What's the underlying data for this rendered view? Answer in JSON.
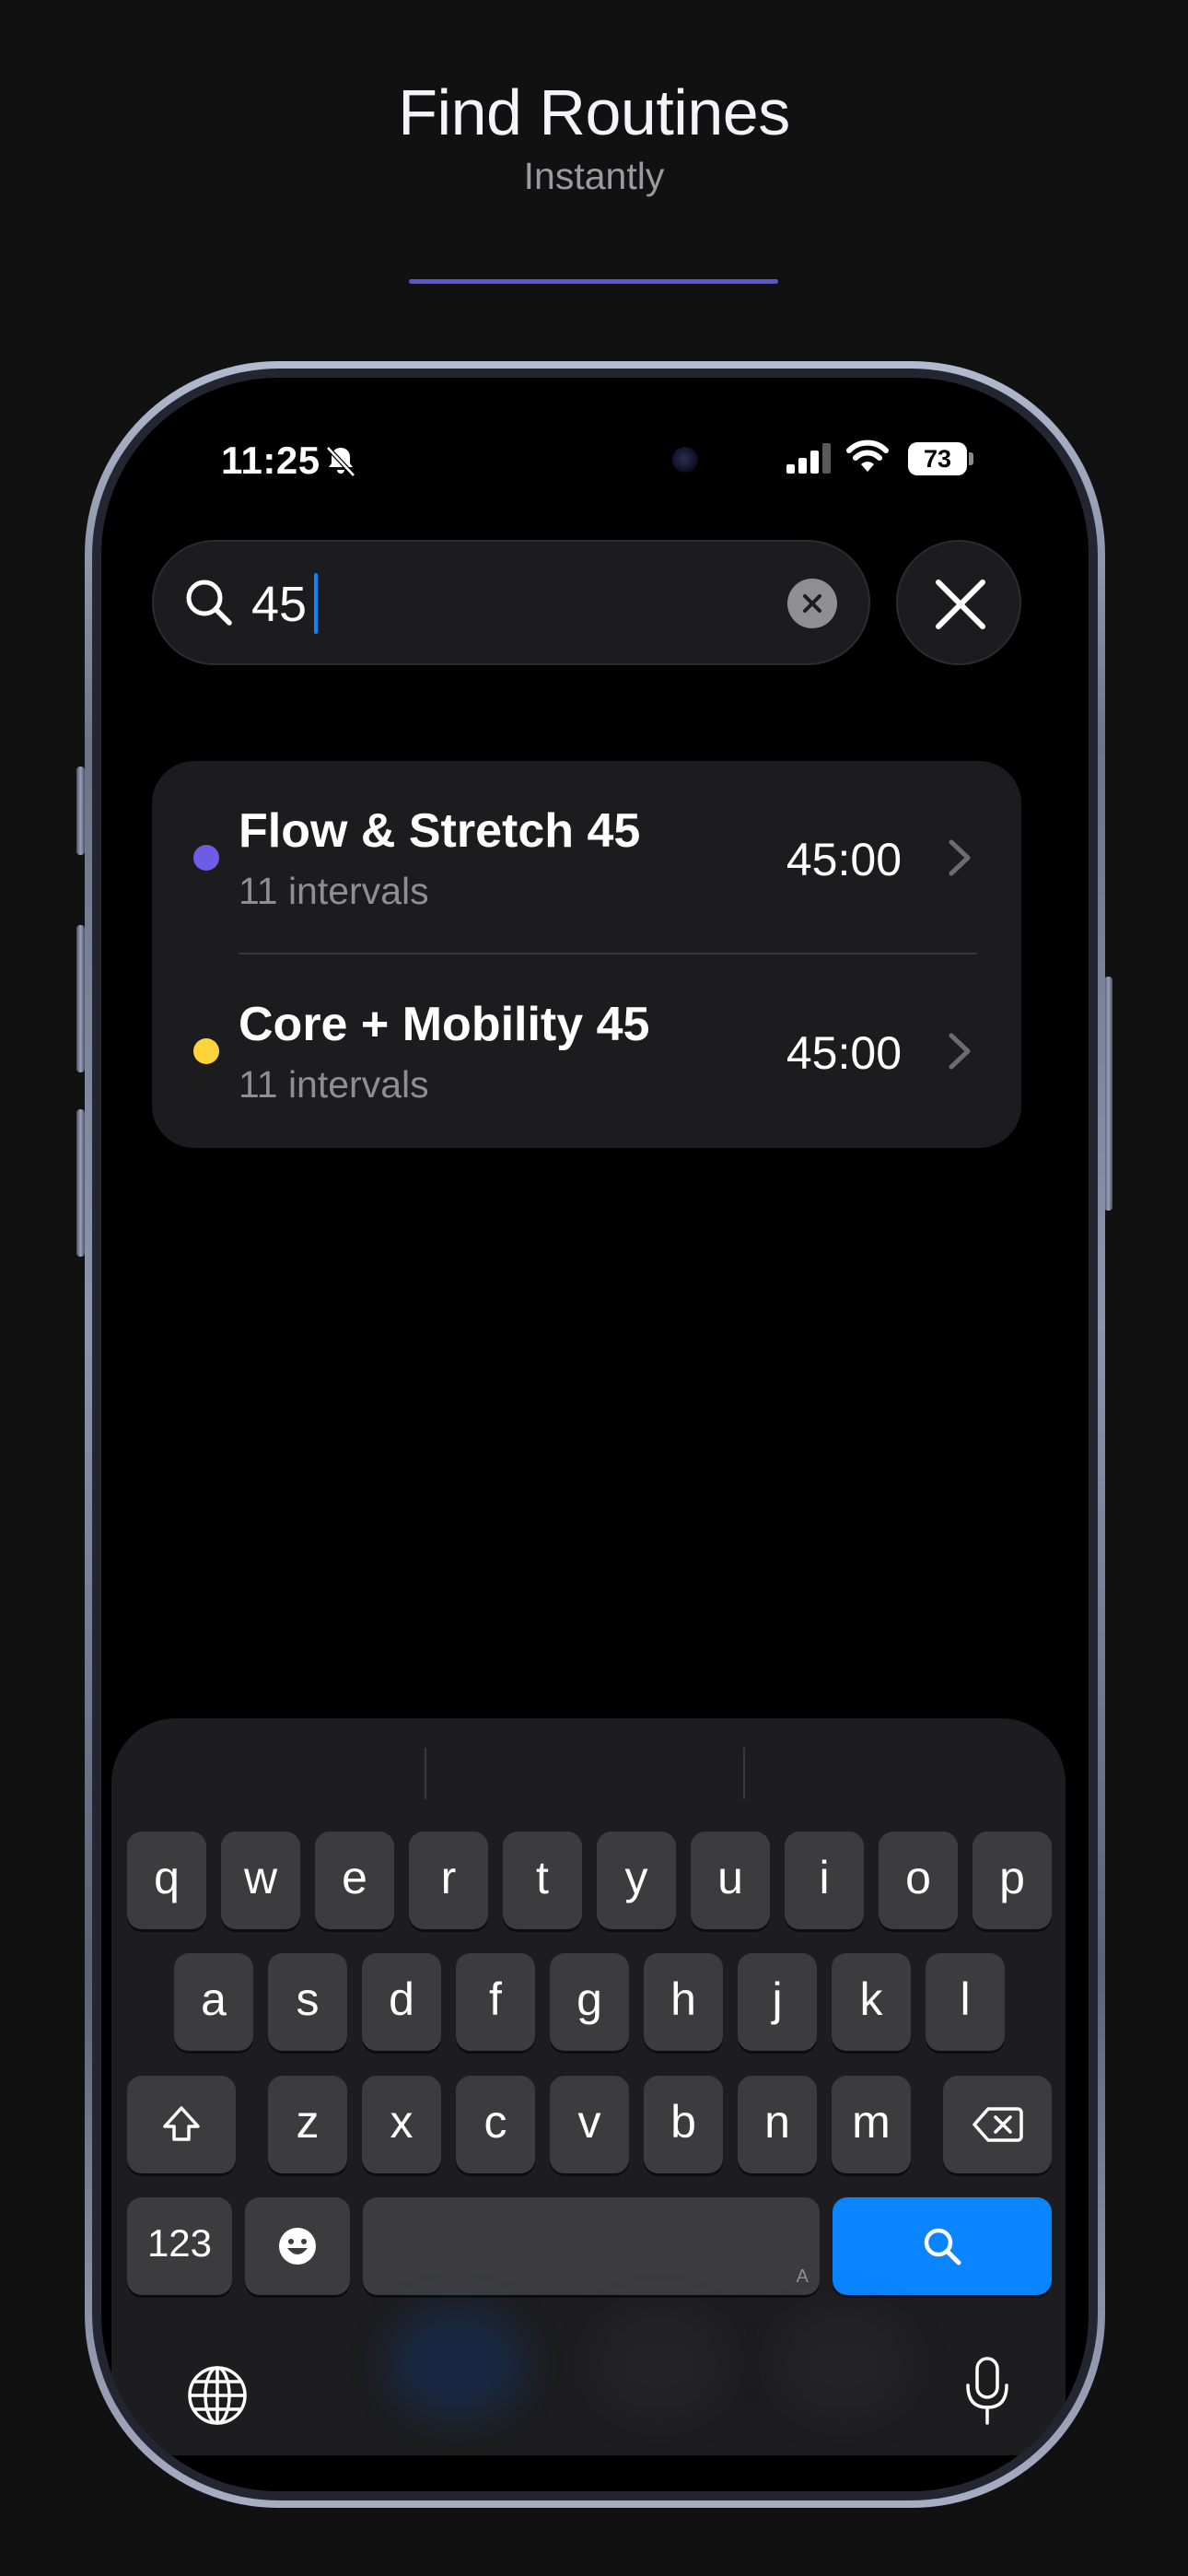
{
  "header": {
    "title": "Find Routines",
    "subtitle": "Instantly"
  },
  "status_bar": {
    "time": "11:25",
    "battery": "73"
  },
  "search": {
    "value": "45"
  },
  "results": [
    {
      "title": "Flow & Stretch 45",
      "subtitle": "11 intervals",
      "duration": "45:00",
      "dot_color": "#6e5ce6"
    },
    {
      "title": "Core + Mobility 45",
      "subtitle": "11 intervals",
      "duration": "45:00",
      "dot_color": "#ffd43b"
    }
  ],
  "keyboard": {
    "row1": [
      "q",
      "w",
      "e",
      "r",
      "t",
      "y",
      "u",
      "i",
      "o",
      "p"
    ],
    "row2": [
      "a",
      "s",
      "d",
      "f",
      "g",
      "h",
      "j",
      "k",
      "l"
    ],
    "row3": [
      "z",
      "x",
      "c",
      "v",
      "b",
      "n",
      "m"
    ],
    "numbers_label": "123",
    "space_hint": "A"
  },
  "colors": {
    "accent": "#5a55d6",
    "search_key": "#0a84ff",
    "caret": "#0a84ff"
  }
}
